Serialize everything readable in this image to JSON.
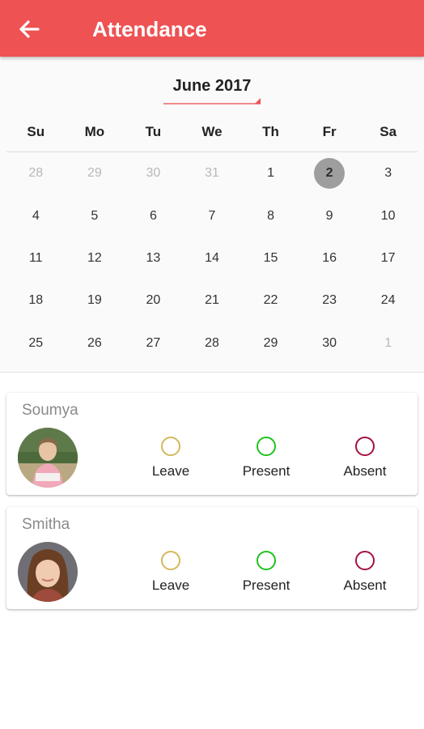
{
  "appbar": {
    "title": "Attendance"
  },
  "calendar": {
    "month": "June 2017",
    "weekdays": [
      "Su",
      "Mo",
      "Tu",
      "We",
      "Th",
      "Fr",
      "Sa"
    ],
    "weeks": [
      [
        "28",
        "29",
        "30",
        "31",
        "1",
        "2",
        "3"
      ],
      [
        "4",
        "5",
        "6",
        "7",
        "8",
        "9",
        "10"
      ],
      [
        "11",
        "12",
        "13",
        "14",
        "15",
        "16",
        "17"
      ],
      [
        "18",
        "19",
        "20",
        "21",
        "22",
        "23",
        "24"
      ],
      [
        "25",
        "26",
        "27",
        "28",
        "29",
        "30",
        "1"
      ]
    ],
    "selected_day": "2"
  },
  "students": [
    {
      "name": "Soumya",
      "options": {
        "leave": "Leave",
        "present": "Present",
        "absent": "Absent"
      }
    },
    {
      "name": "Smitha",
      "options": {
        "leave": "Leave",
        "present": "Present",
        "absent": "Absent"
      }
    }
  ],
  "colors": {
    "accent": "#ee5253",
    "leave": "#d4b85a",
    "present": "#1fc21f",
    "absent": "#a3123c"
  }
}
